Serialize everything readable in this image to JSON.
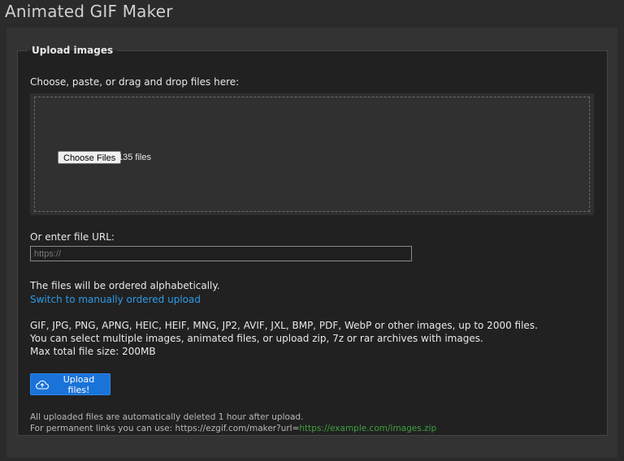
{
  "page": {
    "title": "Animated GIF Maker"
  },
  "upload": {
    "legend": "Upload images",
    "instruction": "Choose, paste, or drag and drop files here:",
    "choose_files_label": "Choose Files",
    "file_count": "135 files",
    "url_label": "Or enter file URL:",
    "url_placeholder": "https://",
    "url_value": "",
    "order_note": "The files will be ordered alphabetically.",
    "order_link": "Switch to manually ordered upload",
    "formats_line1": "GIF, JPG, PNG, APNG, HEIC, HEIF, MNG, JP2, AVIF, JXL, BMP, PDF, WebP or other images, up to 2000 files.",
    "formats_line2": "You can select multiple images, animated files, or upload zip, 7z or rar archives with images.",
    "formats_line3": "Max total file size: 200MB",
    "upload_button_label": "Upload files!",
    "upload_icon": "cloud-upload-icon",
    "footer_line1": "All uploaded files are automatically deleted 1 hour after upload.",
    "footer_line2_prefix": "For permanent links you can use: https://ezgif.com/maker?url=",
    "footer_line2_link": "https://example.com/images.zip"
  },
  "colors": {
    "background": "#2b2b2b",
    "panel": "#212121",
    "accent_blue": "#1a73d9",
    "link_blue": "#2d9be8",
    "link_green": "#3fa13f"
  }
}
